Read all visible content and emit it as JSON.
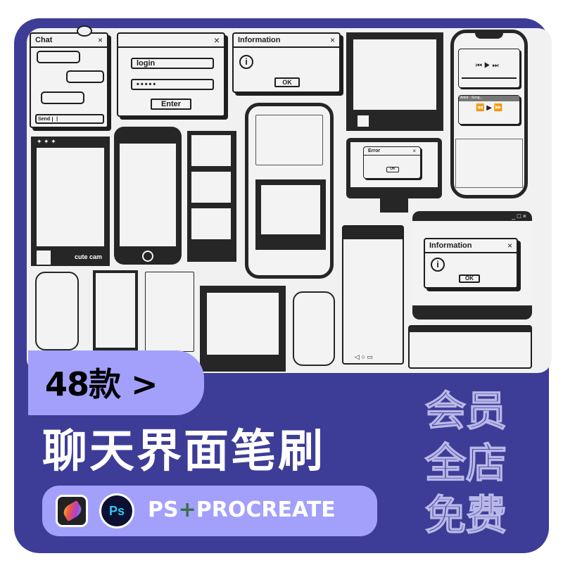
{
  "banner": {
    "count_label": "48款 >",
    "title": "聊天界面笔刷",
    "apps_prefix": "PS",
    "apps_plus": "+",
    "apps_suffix": "PROCREATE",
    "promo_lines": [
      "会员",
      "全店",
      "免费"
    ],
    "colors": {
      "frame": "#3d3d97",
      "accent": "#a3a0fb",
      "ink": "#1e1e1e",
      "paper": "#f1f1f1"
    }
  },
  "icons": {
    "procreate": "procreate-app-icon",
    "photoshop": "photoshop-app-icon",
    "photoshop_label": "Ps"
  },
  "mockups": {
    "chat": {
      "title": "Chat",
      "close": "×",
      "send": "Send",
      "input": "|"
    },
    "login": {
      "close": "×",
      "username": "login",
      "password": "•••••",
      "enter": "Enter"
    },
    "info_top": {
      "title": "Information",
      "close": "×",
      "icon": "i",
      "ok": "OK"
    },
    "info_bottom": {
      "title": "Information",
      "close": "×",
      "icon": "i",
      "ok": "OK"
    },
    "error": {
      "title": "Error",
      "close": "×",
      "ok": "OK"
    },
    "camera": {
      "brand": "cute cam"
    },
    "music_player": {
      "track": "Artist - Song..."
    },
    "window_controls": "_ □ ×"
  }
}
